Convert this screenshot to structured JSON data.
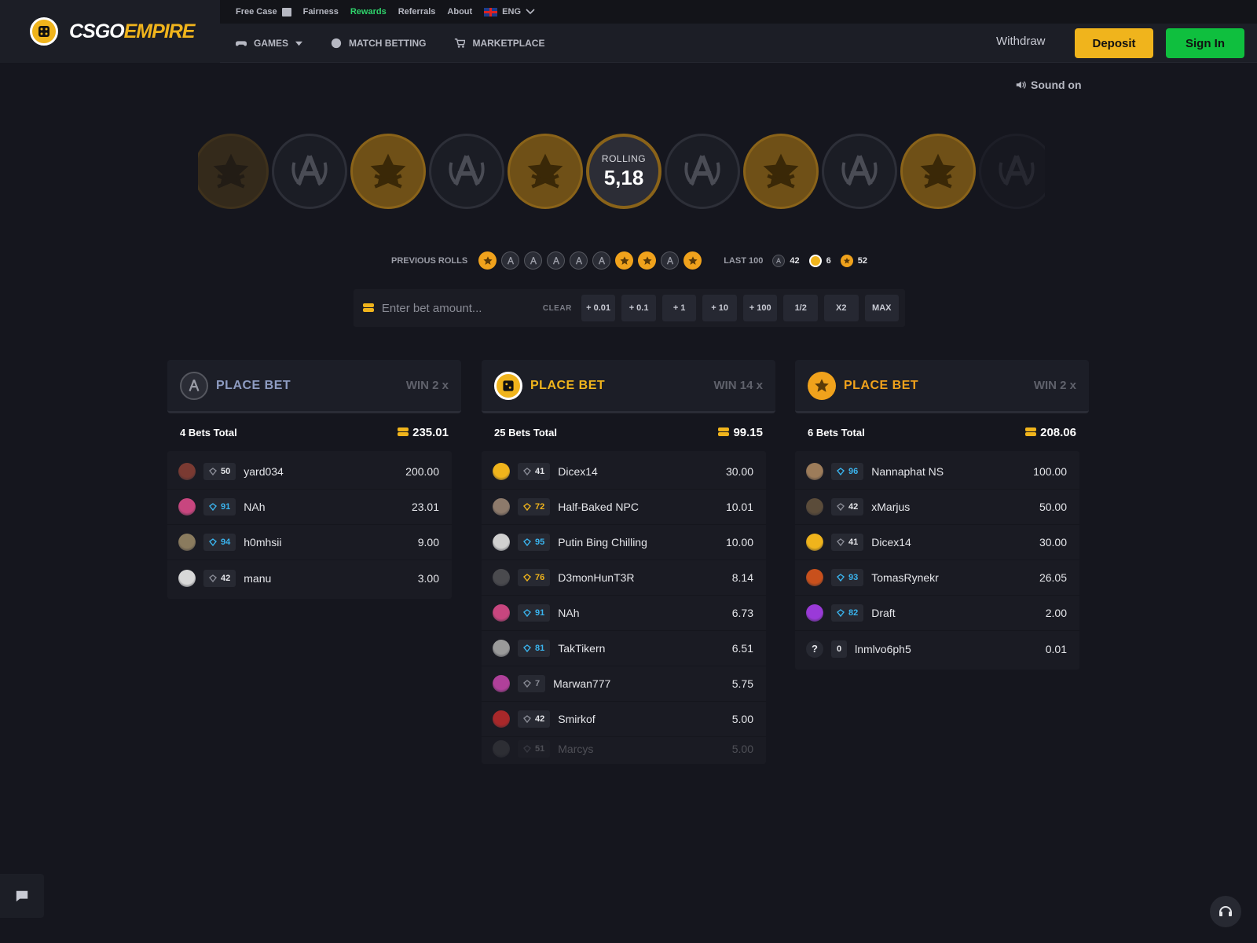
{
  "brand": {
    "part1": "CSGO",
    "part2": "EMPIRE"
  },
  "topbar": {
    "free_case": "Free Case",
    "fairness": "Fairness",
    "rewards": "Rewards",
    "referrals": "Referrals",
    "about": "About",
    "language": "ENG"
  },
  "nav": {
    "games": "GAMES",
    "match_betting": "MATCH BETTING",
    "marketplace": "MARKETPLACE"
  },
  "auth": {
    "withdraw": "Withdraw",
    "deposit": "Deposit",
    "sign_in": "Sign In"
  },
  "sound": "Sound on",
  "roll": {
    "label": "ROLLING",
    "value": "5,18"
  },
  "strip": [
    "t",
    "ct",
    "t",
    "ct",
    "t",
    "roll",
    "ct",
    "t",
    "ct",
    "t",
    "ct"
  ],
  "previous_rolls": {
    "label": "PREVIOUS ROLLS",
    "rolls": [
      "t",
      "ct",
      "ct",
      "ct",
      "ct",
      "ct",
      "t",
      "t",
      "ct",
      "t"
    ],
    "last100_label": "LAST 100",
    "counts": {
      "ct": "42",
      "bonus": "6",
      "t": "52"
    }
  },
  "bet_input": {
    "placeholder": "Enter bet amount...",
    "clear": "CLEAR",
    "quick": [
      "+ 0.01",
      "+ 0.1",
      "+ 1",
      "+ 10",
      "+ 100",
      "1/2",
      "X2",
      "MAX"
    ]
  },
  "columns": [
    {
      "place": "PLACE BET",
      "win": "WIN 2 x",
      "total_label": "4 Bets Total",
      "total_amount": "235.01",
      "bets": [
        {
          "level": "50",
          "tier": "grey",
          "user": "yard034",
          "amount": "200.00",
          "avatar": "#7a3a32"
        },
        {
          "level": "91",
          "tier": "blue",
          "user": "NAh",
          "amount": "23.01",
          "avatar": "#c8467f"
        },
        {
          "level": "94",
          "tier": "blue",
          "user": "h0mhsii",
          "amount": "9.00",
          "avatar": "#8a7b5e"
        },
        {
          "level": "42",
          "tier": "grey",
          "user": "manu",
          "amount": "3.00",
          "avatar": "#d8d8d8"
        }
      ]
    },
    {
      "place": "PLACE BET",
      "win": "WIN 14 x",
      "total_label": "25 Bets Total",
      "total_amount": "99.15",
      "bets": [
        {
          "level": "41",
          "tier": "grey",
          "user": "Dicex14",
          "amount": "30.00",
          "avatar": "#f0b41c"
        },
        {
          "level": "72",
          "tier": "gold",
          "user": "Half-Baked NPC",
          "amount": "10.01",
          "avatar": "#8d7a6b"
        },
        {
          "level": "95",
          "tier": "blue",
          "user": "Putin Bing Chilling",
          "amount": "10.00",
          "avatar": "#d0d0d0"
        },
        {
          "level": "76",
          "tier": "gold",
          "user": "D3monHunT3R",
          "amount": "8.14",
          "avatar": "#4a4a4e"
        },
        {
          "level": "91",
          "tier": "blue",
          "user": "NAh",
          "amount": "6.73",
          "avatar": "#c8467f"
        },
        {
          "level": "81",
          "tier": "blue",
          "user": "TakTikern",
          "amount": "6.51",
          "avatar": "#9a9a9a"
        },
        {
          "level": "7",
          "tier": "dim",
          "user": "Marwan777",
          "amount": "5.75",
          "avatar": "#b0409a"
        },
        {
          "level": "42",
          "tier": "grey",
          "user": "Smirkof",
          "amount": "5.00",
          "avatar": "#a8282a"
        },
        {
          "level": "51",
          "tier": "grey",
          "user": "Marcys",
          "amount": "5.00",
          "avatar": "#666"
        }
      ]
    },
    {
      "place": "PLACE BET",
      "win": "WIN 2 x",
      "total_label": "6 Bets Total",
      "total_amount": "208.06",
      "bets": [
        {
          "level": "96",
          "tier": "blue",
          "user": "Nannaphat NS",
          "amount": "100.00",
          "avatar": "#9d7c5a"
        },
        {
          "level": "42",
          "tier": "grey",
          "user": "xMarjus",
          "amount": "50.00",
          "avatar": "#5b4c3a"
        },
        {
          "level": "41",
          "tier": "grey",
          "user": "Dicex14",
          "amount": "30.00",
          "avatar": "#f0b41c"
        },
        {
          "level": "93",
          "tier": "blue",
          "user": "TomasRynekr",
          "amount": "26.05",
          "avatar": "#c8501c"
        },
        {
          "level": "82",
          "tier": "blue",
          "user": "Draft",
          "amount": "2.00",
          "avatar": "#9a3ad8"
        },
        {
          "level": "0",
          "tier": "none",
          "user": "lnmlvo6ph5",
          "amount": "0.01",
          "avatar": "unknown",
          "avatar_glyph": "?"
        }
      ]
    }
  ],
  "colors": {
    "accent": "#f0b41c",
    "green": "#0fbf3e",
    "background": "#15161e",
    "level_blue": "#3ab4ee"
  },
  "icons": [
    "gift-icon",
    "flag-icon",
    "gamepad-icon",
    "globe-icon",
    "cart-icon",
    "speaker-icon",
    "t-coin-icon",
    "ct-coin-icon",
    "bonus-dice-icon",
    "coin-stack-icon",
    "chat-icon",
    "headset-icon"
  ]
}
